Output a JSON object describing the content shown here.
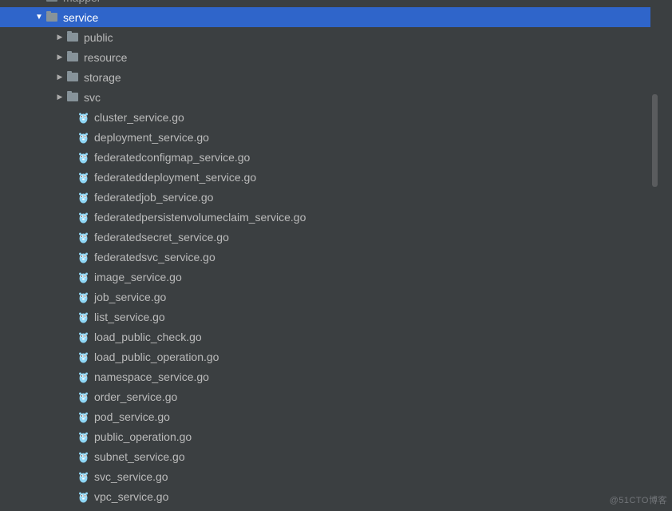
{
  "tree": {
    "top_partial": {
      "label": "mapper",
      "type": "folder"
    },
    "selected": {
      "label": "service",
      "type": "folder",
      "expanded": true
    },
    "subfolders": [
      {
        "label": "public",
        "type": "folder",
        "expanded": false
      },
      {
        "label": "resource",
        "type": "folder",
        "expanded": false
      },
      {
        "label": "storage",
        "type": "folder",
        "expanded": false
      },
      {
        "label": "svc",
        "type": "folder",
        "expanded": false
      }
    ],
    "files": [
      {
        "label": "cluster_service.go",
        "type": "go"
      },
      {
        "label": "deployment_service.go",
        "type": "go"
      },
      {
        "label": "federatedconfigmap_service.go",
        "type": "go"
      },
      {
        "label": "federateddeployment_service.go",
        "type": "go"
      },
      {
        "label": "federatedjob_service.go",
        "type": "go"
      },
      {
        "label": "federatedpersistenvolumeclaim_service.go",
        "type": "go"
      },
      {
        "label": "federatedsecret_service.go",
        "type": "go"
      },
      {
        "label": "federatedsvc_service.go",
        "type": "go"
      },
      {
        "label": "image_service.go",
        "type": "go"
      },
      {
        "label": "job_service.go",
        "type": "go"
      },
      {
        "label": "list_service.go",
        "type": "go"
      },
      {
        "label": "load_public_check.go",
        "type": "go"
      },
      {
        "label": "load_public_operation.go",
        "type": "go"
      },
      {
        "label": "namespace_service.go",
        "type": "go"
      },
      {
        "label": "order_service.go",
        "type": "go"
      },
      {
        "label": "pod_service.go",
        "type": "go"
      },
      {
        "label": "public_operation.go",
        "type": "go"
      },
      {
        "label": "subnet_service.go",
        "type": "go"
      },
      {
        "label": "svc_service.go",
        "type": "go"
      },
      {
        "label": "vpc_service.go",
        "type": "go"
      }
    ]
  },
  "watermark": "@51CTO博客",
  "colors": {
    "background": "#3b3f41",
    "selected": "#2f65ca",
    "text": "#bbbbbb",
    "gopher": "#8ed6f5"
  }
}
